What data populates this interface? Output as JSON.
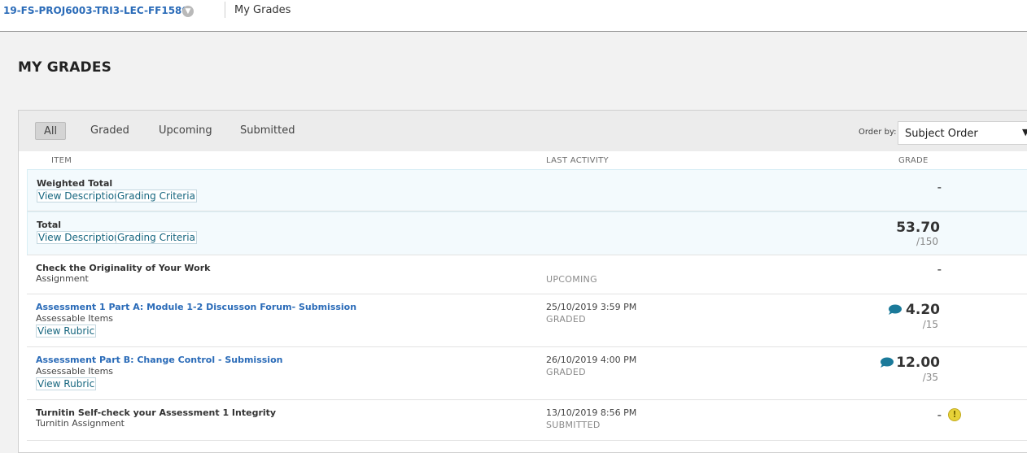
{
  "header": {
    "course_code": "19-FS-PROJ6003-TRI3-LEC-FF1580",
    "breadcrumb": "My Grades"
  },
  "page_title": "MY GRADES",
  "filters": {
    "tabs": [
      "All",
      "Graded",
      "Upcoming",
      "Submitted"
    ],
    "selected": "All",
    "order_by_label": "Order by:",
    "order_by_value": "Subject Order"
  },
  "columns": {
    "item": "ITEM",
    "activity": "LAST ACTIVITY",
    "grade": "GRADE"
  },
  "rows": [
    {
      "title": "Weighted Total",
      "type": "",
      "links": [
        "View Description",
        "Grading Criteria"
      ],
      "date": "",
      "status": "",
      "grade": "-",
      "out_of": ""
    },
    {
      "title": "Total",
      "type": "",
      "links": [
        "View Description",
        "Grading Criteria"
      ],
      "date": "",
      "status": "",
      "grade": "53.70",
      "out_of": "/150"
    },
    {
      "title": "Check the Originality of Your Work",
      "type": "Assignment",
      "links": [],
      "date": "",
      "status": "UPCOMING",
      "grade": "-",
      "out_of": ""
    },
    {
      "title": "Assessment 1 Part A: Module 1-2 Discusson Forum- Submission",
      "type": "Assessable Items",
      "links": [
        "View Rubric"
      ],
      "date": "25/10/2019 3:59 PM",
      "status": "GRADED",
      "grade": "4.20",
      "out_of": "/15"
    },
    {
      "title": "Assessment Part B: Change Control - Submission",
      "type": "Assessable Items",
      "links": [
        "View Rubric"
      ],
      "date": "26/10/2019 4:00 PM",
      "status": "GRADED",
      "grade": "12.00",
      "out_of": "/35"
    },
    {
      "title": "Turnitin Self-check your Assessment 1 Integrity",
      "type": "Turnitin Assignment",
      "links": [],
      "date": "13/10/2019 8:56 PM",
      "status": "SUBMITTED",
      "grade": "-",
      "out_of": ""
    }
  ],
  "colors": {
    "link": "#2a6bb8",
    "comment_icon": "#1b7a9a",
    "warning_icon": "#e7d238"
  }
}
